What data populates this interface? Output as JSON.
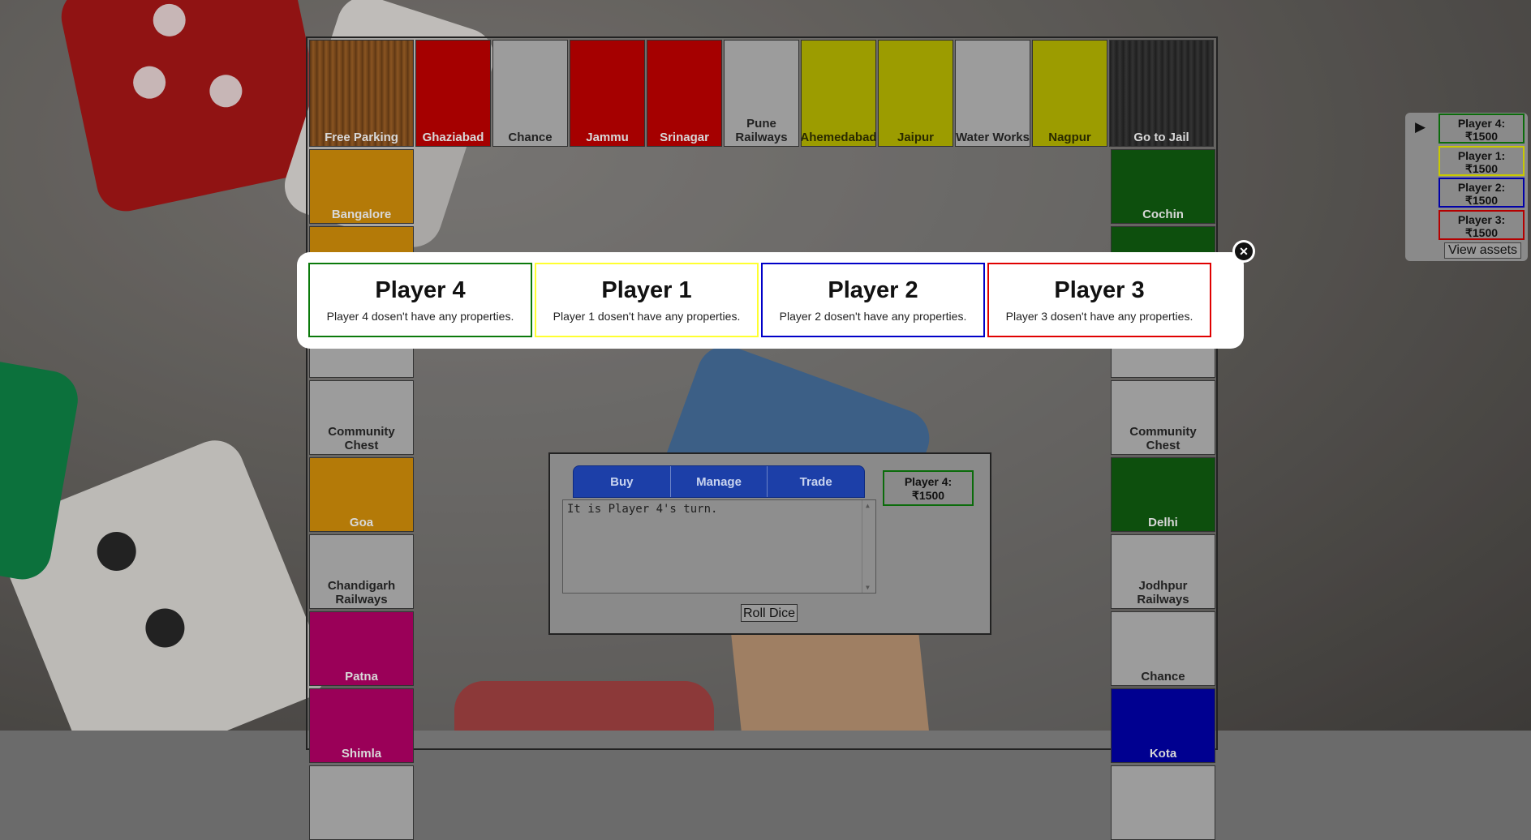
{
  "board": {
    "top_row": [
      {
        "label": "Free Parking",
        "color": "#7a4a1c"
      },
      {
        "label": "Ghaziabad",
        "color": "#a50000"
      },
      {
        "label": "Chance",
        "color": "#9c9c9c"
      },
      {
        "label": "Jammu",
        "color": "#a50000"
      },
      {
        "label": "Srinagar",
        "color": "#a50000"
      },
      {
        "label": "Pune Railways",
        "color": "#9c9c9c"
      },
      {
        "label": "Ahemedabad",
        "color": "#9c9c00"
      },
      {
        "label": "Jaipur",
        "color": "#9c9c00"
      },
      {
        "label": "Water Works",
        "color": "#9c9c9c"
      },
      {
        "label": "Nagpur",
        "color": "#9c9c00"
      },
      {
        "label": "Go to Jail",
        "color": "#2a2a2a"
      }
    ],
    "left_col": [
      {
        "label": "Bangalore",
        "color": "#b47a08"
      },
      {
        "label": "",
        "color": "#b47a08"
      },
      {
        "label": "",
        "color": "#9c9c9c"
      },
      {
        "label": "Community Chest",
        "color": "#9c9c9c"
      },
      {
        "label": "Goa",
        "color": "#b47a08"
      },
      {
        "label": "Chandigarh Railways",
        "color": "#9c9c9c"
      },
      {
        "label": "Patna",
        "color": "#9a0058"
      },
      {
        "label": "Shimla",
        "color": "#9a0058"
      },
      {
        "label": "",
        "color": "#9c9c9c"
      }
    ],
    "right_col": [
      {
        "label": "Cochin",
        "color": "#0d4f0d"
      },
      {
        "label": "",
        "color": "#0d4f0d"
      },
      {
        "label": "",
        "color": "#9c9c9c"
      },
      {
        "label": "Community Chest",
        "color": "#9c9c9c"
      },
      {
        "label": "Delhi",
        "color": "#0d4f0d"
      },
      {
        "label": "Jodhpur Railways",
        "color": "#9c9c9c"
      },
      {
        "label": "Chance",
        "color": "#9c9c9c"
      },
      {
        "label": "Kota",
        "color": "#000090"
      },
      {
        "label": "",
        "color": "#9c9c9c"
      }
    ]
  },
  "panel": {
    "tabs": {
      "buy": "Buy",
      "manage": "Manage",
      "trade": "Trade"
    },
    "log_text": "It is Player 4's turn.",
    "roll_label": "Roll Dice",
    "current_player": {
      "name": "Player 4:",
      "money": "₹1500"
    }
  },
  "sidebar": {
    "turn_marker": "▶",
    "players": [
      {
        "name": "Player 4:",
        "money": "₹1500",
        "color": "#0b6b0b"
      },
      {
        "name": "Player 1:",
        "money": "₹1500",
        "color": "#c9c900"
      },
      {
        "name": "Player 2:",
        "money": "₹1500",
        "color": "#0000a8"
      },
      {
        "name": "Player 3:",
        "money": "₹1500",
        "color": "#b40000"
      }
    ],
    "view_assets": "View assets"
  },
  "popup": {
    "close_symbol": "✕",
    "cards": [
      {
        "name": "Player 4",
        "desc": "Player 4 dosen't have any properties.",
        "color": "#0b7a0b"
      },
      {
        "name": "Player 1",
        "desc": "Player 1 dosen't have any properties.",
        "color": "#ffff30"
      },
      {
        "name": "Player 2",
        "desc": "Player 2 dosen't have any properties.",
        "color": "#0000c8"
      },
      {
        "name": "Player 3",
        "desc": "Player 3 dosen't have any properties.",
        "color": "#e00000"
      }
    ]
  }
}
